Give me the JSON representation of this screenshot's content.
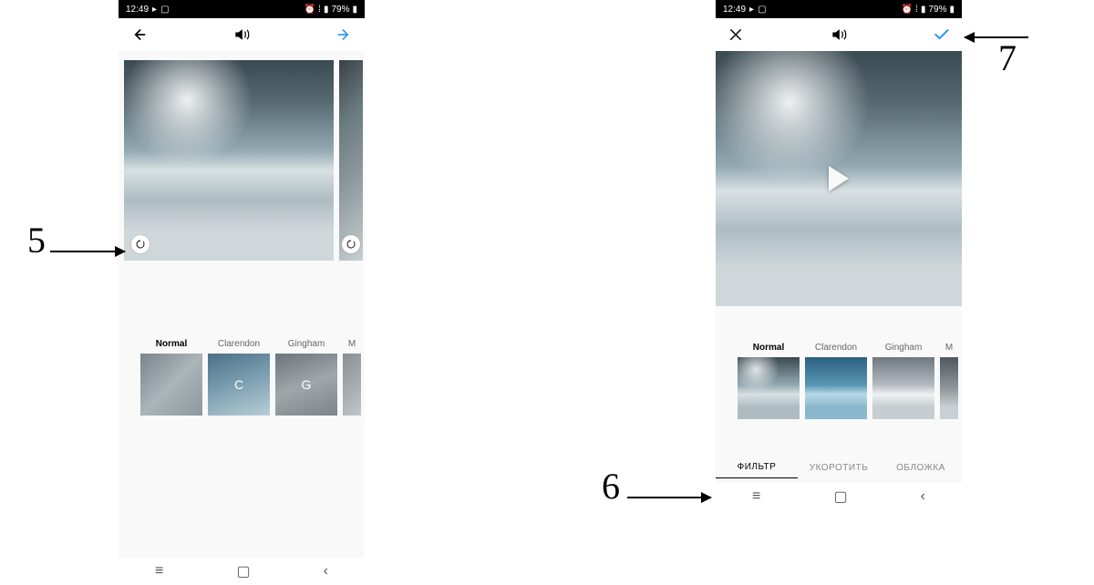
{
  "status": {
    "time": "12:49",
    "battery": "79%"
  },
  "screenA": {
    "filters": [
      {
        "label": "Normal",
        "letter": ""
      },
      {
        "label": "Clarendon",
        "letter": "C"
      },
      {
        "label": "Gingham",
        "letter": "G"
      },
      {
        "label": "M",
        "letter": ""
      }
    ]
  },
  "screenB": {
    "filters": [
      {
        "label": "Normal"
      },
      {
        "label": "Clarendon"
      },
      {
        "label": "Gingham"
      },
      {
        "label": "M"
      }
    ],
    "tabs": {
      "filter": "ФИЛЬТР",
      "trim": "УКОРОТИТЬ",
      "cover": "ОБЛОЖКА"
    }
  },
  "annotations": {
    "step5": "5",
    "step6": "6",
    "step7": "7"
  }
}
